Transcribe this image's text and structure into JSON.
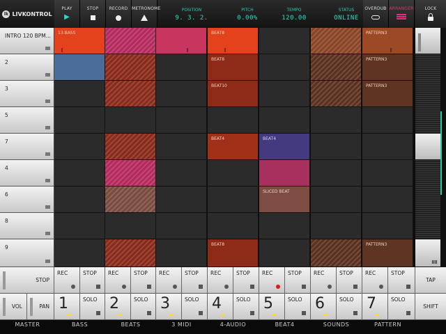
{
  "app": {
    "logo_text": "LIVKONTROL",
    "logo_icon": "lk"
  },
  "transport": {
    "play": "PLAY",
    "stop": "STOP",
    "record": "RECORD",
    "metronome": "METRONOME",
    "position_label": "POSITION",
    "position": "9. 3. 2.",
    "pitch_label": "PITCH",
    "pitch": "0.00%",
    "tempo_label": "TEMPO",
    "tempo": "120.00",
    "status_label": "STATUS",
    "status": "ONLINE",
    "overdub": "OVERDUB",
    "arranger": "ARRANGER",
    "lock": "LOCK"
  },
  "colors": {
    "accent": "#1fe0c0",
    "arranger": "#e0307a",
    "rec_armed": "#e01818",
    "track_dot": "#f4df2a"
  },
  "scenes": [
    "INTRO 120 BPM...",
    "2",
    "3",
    "5",
    "7",
    "4",
    "6",
    "8",
    "9"
  ],
  "clips": {
    "c0_0": "13-BASS",
    "c0_3": "BEAT8",
    "c0_6": "PATTERN3",
    "c1_3": "BEAT8",
    "c1_6": "PATTERN3",
    "c2_3": "BEAT10",
    "c2_6": "PATTERN3",
    "c4_3": "BEAT4",
    "c4_4": "BEAT4",
    "c6_4": "SLICED BEAT",
    "c8_3": "BEAT8",
    "c8_6": "PATTERN3"
  },
  "controls": {
    "master_stop": "STOP",
    "rec": "REC",
    "stop": "STOP",
    "solo": "SOLO",
    "vol": "VOL",
    "pan": "PAN",
    "tap": "TAP",
    "shift": "SHIFT"
  },
  "track_numbers": [
    "1",
    "2",
    "3",
    "4",
    "5",
    "6",
    "7"
  ],
  "tracks": [
    "MASTER",
    "BASS",
    "BEATS",
    "3 MIDI",
    "4-AUDIO",
    "BEAT4",
    "SOUNDS",
    "PATTERN"
  ]
}
